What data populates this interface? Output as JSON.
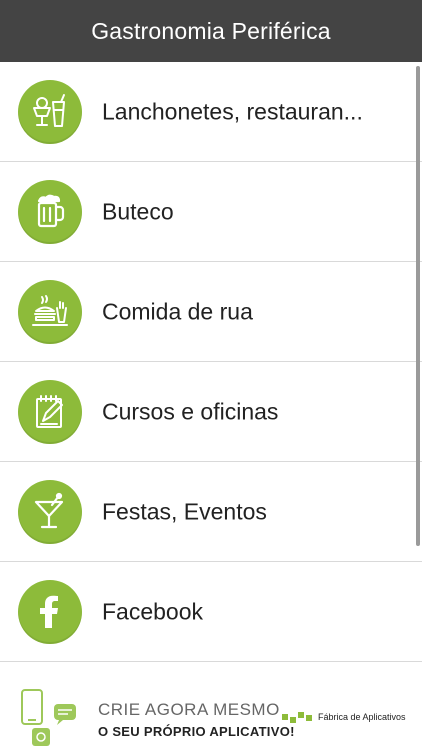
{
  "header": {
    "title": "Gastronomia Periférica"
  },
  "theme": {
    "header_bg": "#444444",
    "icon_bg": "#8dbb3a",
    "divider": "#d9d9d9"
  },
  "menu": {
    "items": [
      {
        "label": "Lanchonetes, restauran...",
        "icon": "ice-cream-drink-icon"
      },
      {
        "label": "Buteco",
        "icon": "beer-mug-icon"
      },
      {
        "label": "Comida de rua",
        "icon": "street-food-icon"
      },
      {
        "label": "Cursos e oficinas",
        "icon": "notepad-pencil-icon"
      },
      {
        "label": "Festas, Eventos",
        "icon": "cocktail-icon"
      },
      {
        "label": "Facebook",
        "icon": "facebook-icon"
      }
    ]
  },
  "ad": {
    "line1": "CRIE AGORA MESMO",
    "line2": "O SEU PRÓPRIO APLICATIVO!",
    "brand": "Fábrica de Aplicativos",
    "brand_color": "#8dbb3a"
  }
}
